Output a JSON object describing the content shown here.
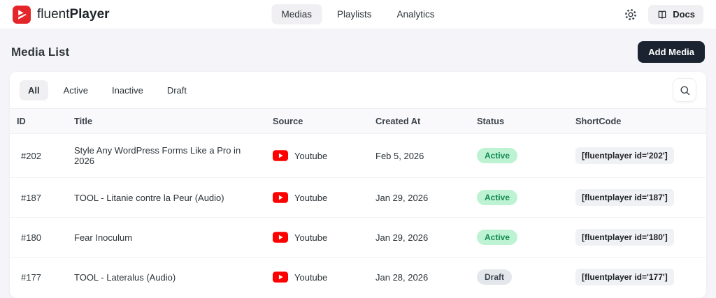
{
  "brand": {
    "name_light": "fluent",
    "name_bold": "Player"
  },
  "header": {
    "nav": [
      {
        "label": "Medias",
        "active": true
      },
      {
        "label": "Playlists",
        "active": false
      },
      {
        "label": "Analytics",
        "active": false
      }
    ],
    "docs_label": "Docs"
  },
  "page": {
    "title": "Media List",
    "add_button": "Add Media"
  },
  "filters": [
    {
      "label": "All",
      "active": true
    },
    {
      "label": "Active",
      "active": false
    },
    {
      "label": "Inactive",
      "active": false
    },
    {
      "label": "Draft",
      "active": false
    }
  ],
  "table": {
    "columns": [
      "ID",
      "Title",
      "Source",
      "Created At",
      "Status",
      "ShortCode"
    ],
    "rows": [
      {
        "id": "#202",
        "title": "Style Any WordPress Forms Like a Pro in 2026",
        "source": "Youtube",
        "created": "Feb 5, 2026",
        "status": "Active",
        "shortcode": "[fluentplayer id='202']"
      },
      {
        "id": "#187",
        "title": "TOOL - Litanie contre la Peur (Audio)",
        "source": "Youtube",
        "created": "Jan 29, 2026",
        "status": "Active",
        "shortcode": "[fluentplayer id='187']"
      },
      {
        "id": "#180",
        "title": "Fear Inoculum",
        "source": "Youtube",
        "created": "Jan 29, 2026",
        "status": "Active",
        "shortcode": "[fluentplayer id='180']"
      },
      {
        "id": "#177",
        "title": "TOOL - Lateralus (Audio)",
        "source": "Youtube",
        "created": "Jan 28, 2026",
        "status": "Draft",
        "shortcode": "[fluentplayer id='177']"
      }
    ]
  },
  "colors": {
    "brand_red": "#e4262b",
    "youtube_red": "#fe0000",
    "dark_button": "#1b2230",
    "active_badge_bg": "#bdf3d2",
    "active_badge_text": "#148a50",
    "draft_badge_bg": "#e3e6ea",
    "draft_badge_text": "#3f4754",
    "page_bg": "#f4f4f9"
  }
}
